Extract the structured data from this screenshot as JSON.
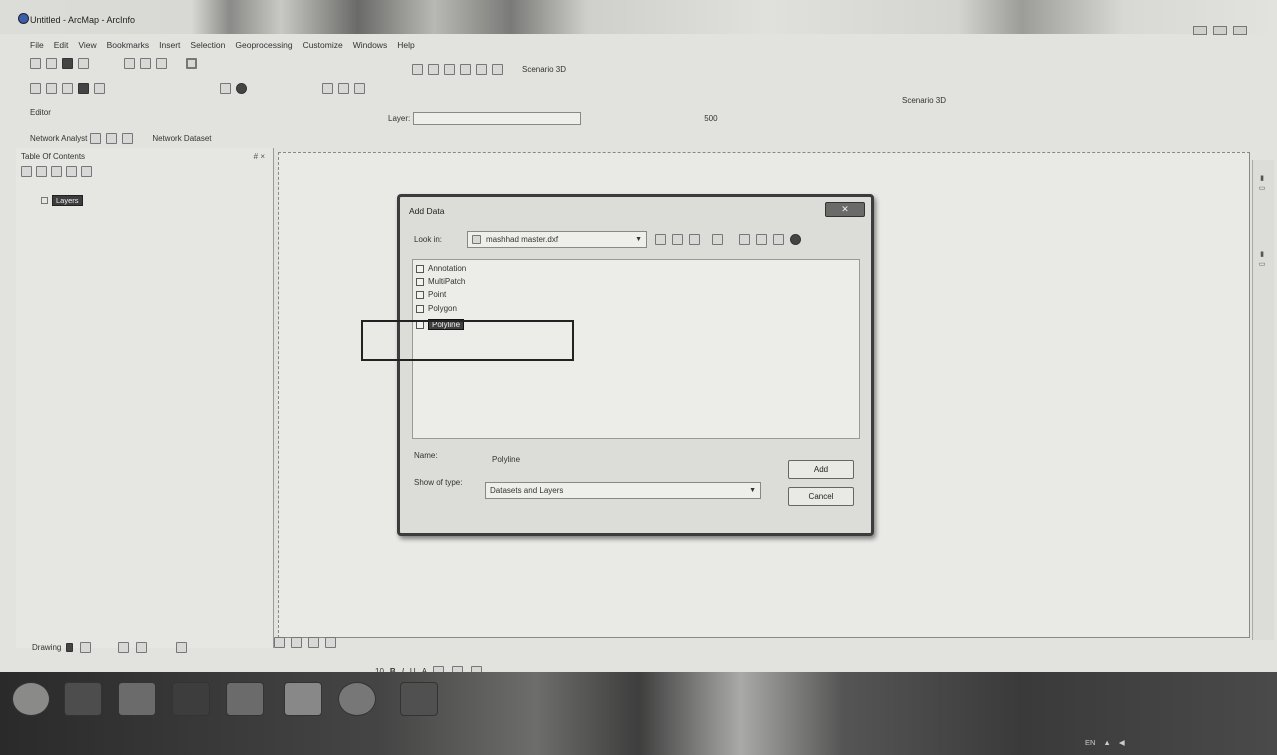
{
  "window": {
    "title": "Untitled - ArcMap - ArcInfo",
    "app_icon": "globe-icon"
  },
  "menu": [
    "File",
    "Edit",
    "View",
    "Bookmarks",
    "Insert",
    "Selection",
    "Geoprocessing",
    "Customize",
    "Windows",
    "Help"
  ],
  "toolbars": {
    "scenario_label": "Scenario 3D",
    "scenario_label_right": "Scenario 3D",
    "editor_label": "Editor",
    "network_analyst_label": "Network Analyst",
    "network_dataset_label": "Network Dataset",
    "layer_label": "Layer:",
    "layer_value": "",
    "value_500": "500"
  },
  "toc": {
    "title": "Table Of Contents",
    "pin": "# ×",
    "layer_name": "Layers"
  },
  "dialog": {
    "title": "Add Data",
    "close_label": "✕",
    "look_in_label": "Look in:",
    "look_in_value": "mashhad master.dxf",
    "items": [
      {
        "label": "Annotation",
        "icon": "annotation-icon",
        "selected": false
      },
      {
        "label": "MultiPatch",
        "icon": "multipatch-icon",
        "selected": false
      },
      {
        "label": "Point",
        "icon": "point-icon",
        "selected": false
      },
      {
        "label": "Polygon",
        "icon": "polygon-icon",
        "selected": false
      },
      {
        "label": "Polyline",
        "icon": "polyline-icon",
        "selected": true
      }
    ],
    "name_label": "Name:",
    "name_value": "Polyline",
    "type_label": "Show of type:",
    "type_value": "Datasets and Layers",
    "add_button": "Add",
    "cancel_button": "Cancel"
  },
  "drawing": {
    "label": "Drawing",
    "font_size": "10",
    "bold": "B",
    "italic": "I",
    "underline": "U",
    "font_color": "A"
  },
  "taskbar": {
    "lang": "EN"
  }
}
